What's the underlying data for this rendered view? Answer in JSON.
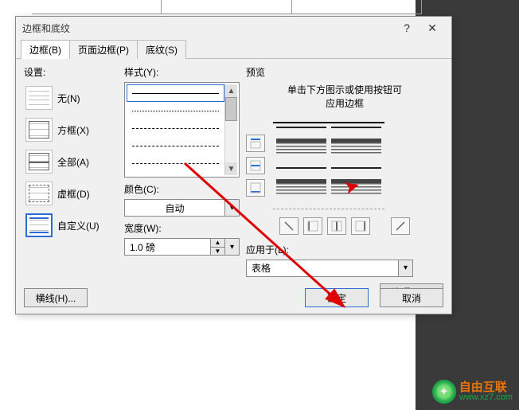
{
  "dialog": {
    "title": "边框和底纹",
    "help": "?",
    "close": "✕"
  },
  "tabs": {
    "borders": "边框(B)",
    "page_borders": "页面边框(P)",
    "shading": "底纹(S)"
  },
  "settings": {
    "label_prefix": "设置:",
    "none": "无(N)",
    "box": "方框(X)",
    "all": "全部(A)",
    "dashed": "虚框(D)",
    "custom": "自定义(U)"
  },
  "style": {
    "label": "样式(Y):",
    "color_label": "颜色(C):",
    "color_value": "自动",
    "width_label": "宽度(W):",
    "width_value": "1.0 磅"
  },
  "preview": {
    "label": "预览",
    "hint_line1": "单击下方图示或使用按钮可",
    "hint_line2": "应用边框",
    "applyto_label": "应用于(L):",
    "applyto_value": "表格",
    "options": "选项(O)..."
  },
  "footer": {
    "hline": "横线(H)...",
    "ok": "确定",
    "cancel": "取消"
  },
  "watermark": {
    "cn": "自由互联",
    "url": "www.xz7.com"
  }
}
